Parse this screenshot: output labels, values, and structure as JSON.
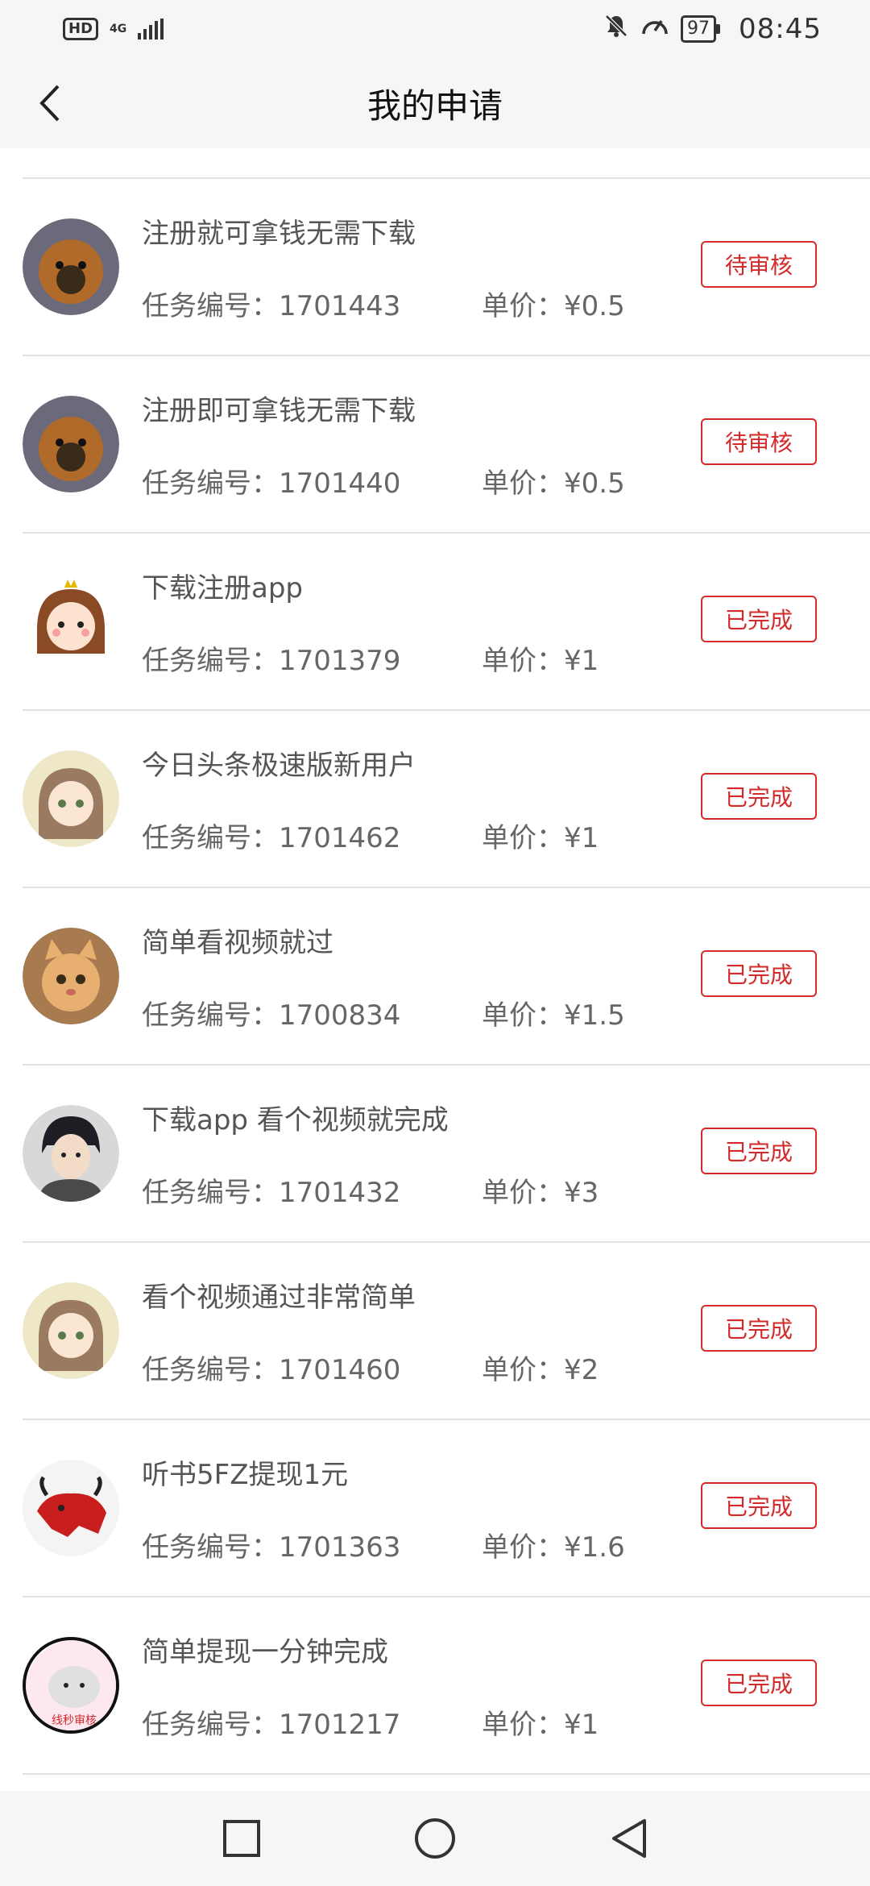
{
  "status_bar": {
    "hd": "HD",
    "network": "4G",
    "battery": "97",
    "time": "08:45"
  },
  "header": {
    "title": "我的申请",
    "back_icon": "chevron-left-icon"
  },
  "labels": {
    "task_no": "任务编号：",
    "price": "单价："
  },
  "tasks": [
    {
      "title": "注册就可拿钱无需下载",
      "id": "1701443",
      "price": "¥0.5",
      "status": "待审核"
    },
    {
      "title": "注册即可拿钱无需下载",
      "id": "1701440",
      "price": "¥0.5",
      "status": "待审核"
    },
    {
      "title": "下载注册app",
      "id": "1701379",
      "price": "¥1",
      "status": "已完成"
    },
    {
      "title": "今日头条极速版新用户",
      "id": "1701462",
      "price": "¥1",
      "status": "已完成"
    },
    {
      "title": "简单看视频就过",
      "id": "1700834",
      "price": "¥1.5",
      "status": "已完成"
    },
    {
      "title": "下载app 看个视频就完成",
      "id": "1701432",
      "price": "¥3",
      "status": "已完成"
    },
    {
      "title": "看个视频通过非常简单",
      "id": "1701460",
      "price": "¥2",
      "status": "已完成"
    },
    {
      "title": "听书5FZ提现1元",
      "id": "1701363",
      "price": "¥1.6",
      "status": "已完成"
    },
    {
      "title": "简单提现一分钟完成",
      "id": "1701217",
      "price": "¥1",
      "status": "已完成",
      "avatar_text": "线秒审核"
    }
  ],
  "colors": {
    "accent_red": "#d42a2a",
    "background": "#f6f6f6"
  },
  "nav_bar": {
    "recent_icon": "square-icon",
    "home_icon": "circle-icon",
    "back_icon": "triangle-back-icon"
  }
}
